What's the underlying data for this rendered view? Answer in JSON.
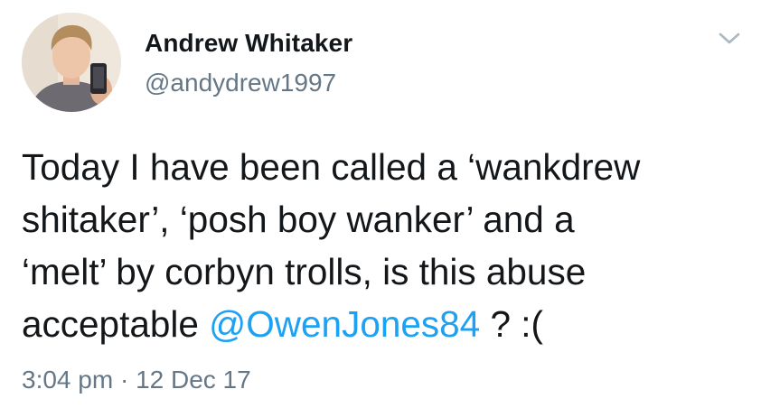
{
  "author": {
    "display_name": "Andrew Whitaker",
    "handle": "@andydrew1997"
  },
  "tweet": {
    "lines": [
      "Today I have been called a ‘wankdrew",
      "shitaker’, ‘posh boy wanker’ and a",
      "‘melt’ by corbyn trolls, is this abuse"
    ],
    "last_line_prefix": "acceptable ",
    "mention": "@OwenJones84",
    "last_line_suffix": " ? :("
  },
  "meta": {
    "time": "3:04 pm",
    "separator": " · ",
    "date": "12 Dec 17"
  },
  "icons": {
    "menu": "chevron-down-icon"
  },
  "colors": {
    "link": "#1da1f2",
    "secondary_text": "#657786",
    "primary_text": "#14171a"
  }
}
